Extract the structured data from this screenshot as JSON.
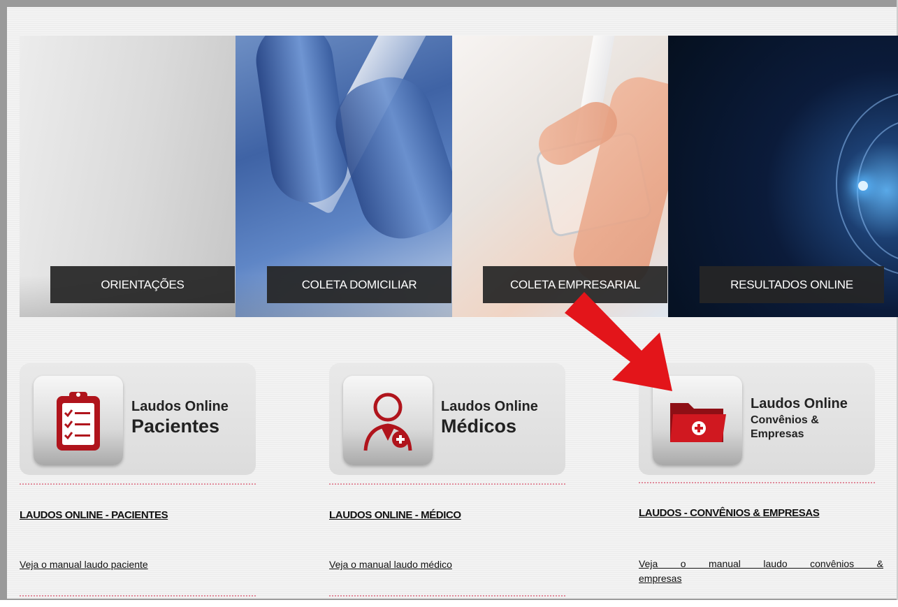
{
  "banner": {
    "labels": [
      "ORIENTAÇÕES",
      "COLETA DOMICILIAR",
      "COLETA EMPRESARIAL",
      "RESULTADOS ONLINE"
    ]
  },
  "cards": [
    {
      "line1": "Laudos Online",
      "line2": "Pacientes",
      "icon": "clipboard-checklist-icon"
    },
    {
      "line1": "Laudos Online",
      "line2": "Médicos",
      "icon": "doctor-icon"
    },
    {
      "line1": "Laudos Online",
      "line2a": "Convênios &",
      "line2b": "Empresas",
      "icon": "medical-folder-icon"
    }
  ],
  "sections": [
    {
      "title": "LAUDOS ONLINE - PACIENTES",
      "manual": "Veja o manual laudo paciente"
    },
    {
      "title": "LAUDOS ONLINE - MÉDICO",
      "manual": "Veja o manual laudo médico"
    },
    {
      "title": "LAUDOS - CONVÊNIOS & EMPRESAS",
      "manual_a": "Veja o manual laudo convênios &",
      "manual_b": "empresas"
    }
  ],
  "colors": {
    "accent_red": "#c0161f",
    "arrow_red": "#e3151a",
    "label_bg": "#262626"
  }
}
